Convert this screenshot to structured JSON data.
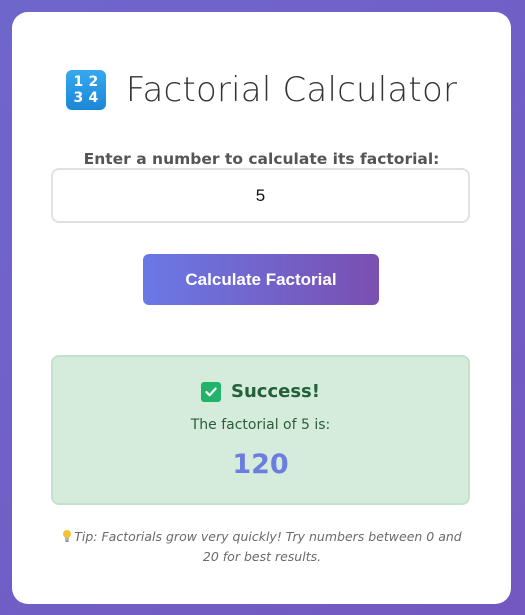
{
  "header": {
    "icon": "input-numbers-icon",
    "icon_digits": [
      "1",
      "2",
      "3",
      "4"
    ],
    "title": "Factorial Calculator"
  },
  "form": {
    "prompt": "Enter a number to calculate its factorial:",
    "input_value": "5",
    "button_label": "Calculate Factorial"
  },
  "result": {
    "status_icon": "check-mark-icon",
    "status_text": "Success!",
    "line": "The factorial of 5 is:",
    "value": "120"
  },
  "tip": {
    "icon": "light-bulb-icon",
    "text": "Tip: Factorials grow very quickly! Try numbers between 0 and 20 for best results."
  },
  "colors": {
    "background_start": "#6f66cc",
    "background_end": "#7258c0",
    "button_start": "#6a79e6",
    "button_end": "#7a4fb0",
    "success_bg": "#d5ebdb",
    "success_text": "#22613a",
    "result_value": "#6b7ee0",
    "check_green": "#22b36b"
  }
}
